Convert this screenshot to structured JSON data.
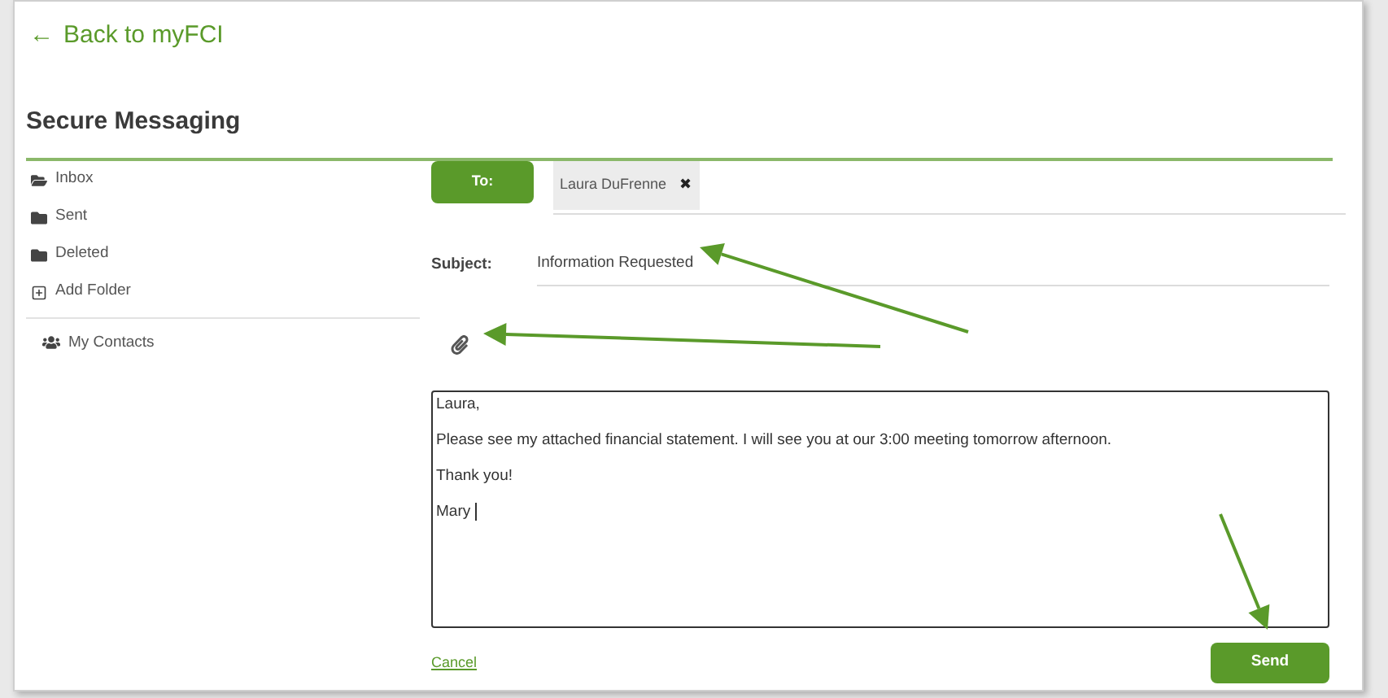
{
  "back_link": {
    "arrow": "←",
    "label": "Back to myFCI"
  },
  "page_title": "Secure Messaging",
  "sidebar": {
    "folders": [
      {
        "kind": "open-folder",
        "label": "Inbox"
      },
      {
        "kind": "folder",
        "label": "Sent"
      },
      {
        "kind": "folder",
        "label": "Deleted"
      },
      {
        "kind": "add-folder",
        "label": "Add Folder"
      }
    ],
    "contacts": {
      "label": "My Contacts"
    }
  },
  "compose": {
    "to_button": "To:",
    "recipients": [
      {
        "name": "Laura DuFrenne",
        "remove": "✖"
      }
    ],
    "subject_label": "Subject:",
    "subject": "Information Requested",
    "body": [
      "Laura,",
      "Please see my attached financial statement. I will see you at our 3:00 meeting tomorrow afternoon.",
      "Thank you!",
      "Mary"
    ],
    "cancel": "Cancel",
    "send": "Send"
  }
}
